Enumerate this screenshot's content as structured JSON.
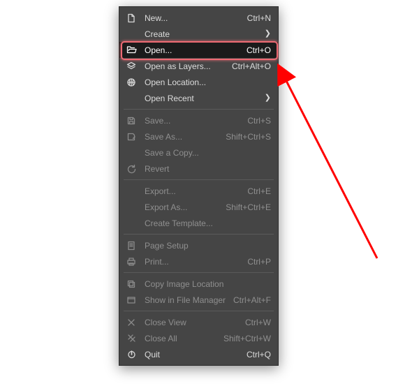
{
  "menu": {
    "groups": [
      [
        {
          "id": "new",
          "icon": "file-new-icon",
          "label": "New...",
          "accel": "Ctrl+N",
          "enabled": true,
          "submenu": false,
          "highlighted": false
        },
        {
          "id": "create",
          "icon": "",
          "label": "Create",
          "accel": "",
          "enabled": true,
          "submenu": true,
          "highlighted": false
        },
        {
          "id": "open",
          "icon": "folder-open-icon",
          "label": "Open...",
          "accel": "Ctrl+O",
          "enabled": true,
          "submenu": false,
          "highlighted": true
        },
        {
          "id": "open-layers",
          "icon": "layers-icon",
          "label": "Open as Layers...",
          "accel": "Ctrl+Alt+O",
          "enabled": true,
          "submenu": false,
          "highlighted": false
        },
        {
          "id": "open-location",
          "icon": "globe-icon",
          "label": "Open Location...",
          "accel": "",
          "enabled": true,
          "submenu": false,
          "highlighted": false
        },
        {
          "id": "open-recent",
          "icon": "",
          "label": "Open Recent",
          "accel": "",
          "enabled": true,
          "submenu": true,
          "highlighted": false
        }
      ],
      [
        {
          "id": "save",
          "icon": "save-icon",
          "label": "Save...",
          "accel": "Ctrl+S",
          "enabled": false,
          "submenu": false,
          "highlighted": false
        },
        {
          "id": "save-as",
          "icon": "save-as-icon",
          "label": "Save As...",
          "accel": "Shift+Ctrl+S",
          "enabled": false,
          "submenu": false,
          "highlighted": false
        },
        {
          "id": "save-copy",
          "icon": "",
          "label": "Save a Copy...",
          "accel": "",
          "enabled": false,
          "submenu": false,
          "highlighted": false
        },
        {
          "id": "revert",
          "icon": "revert-icon",
          "label": "Revert",
          "accel": "",
          "enabled": false,
          "submenu": false,
          "highlighted": false
        }
      ],
      [
        {
          "id": "export",
          "icon": "",
          "label": "Export...",
          "accel": "Ctrl+E",
          "enabled": false,
          "submenu": false,
          "highlighted": false
        },
        {
          "id": "export-as",
          "icon": "",
          "label": "Export As...",
          "accel": "Shift+Ctrl+E",
          "enabled": false,
          "submenu": false,
          "highlighted": false
        },
        {
          "id": "create-template",
          "icon": "",
          "label": "Create Template...",
          "accel": "",
          "enabled": false,
          "submenu": false,
          "highlighted": false
        }
      ],
      [
        {
          "id": "page-setup",
          "icon": "page-setup-icon",
          "label": "Page Setup",
          "accel": "",
          "enabled": false,
          "submenu": false,
          "highlighted": false
        },
        {
          "id": "print",
          "icon": "print-icon",
          "label": "Print...",
          "accel": "Ctrl+P",
          "enabled": false,
          "submenu": false,
          "highlighted": false
        }
      ],
      [
        {
          "id": "copy-location",
          "icon": "copy-location-icon",
          "label": "Copy Image Location",
          "accel": "",
          "enabled": false,
          "submenu": false,
          "highlighted": false
        },
        {
          "id": "show-file-mgr",
          "icon": "file-manager-icon",
          "label": "Show in File Manager",
          "accel": "Ctrl+Alt+F",
          "enabled": false,
          "submenu": false,
          "highlighted": false
        }
      ],
      [
        {
          "id": "close-view",
          "icon": "close-icon",
          "label": "Close View",
          "accel": "Ctrl+W",
          "enabled": false,
          "submenu": false,
          "highlighted": false
        },
        {
          "id": "close-all",
          "icon": "close-all-icon",
          "label": "Close All",
          "accel": "Shift+Ctrl+W",
          "enabled": false,
          "submenu": false,
          "highlighted": false
        },
        {
          "id": "quit",
          "icon": "quit-icon",
          "label": "Quit",
          "accel": "Ctrl+Q",
          "enabled": true,
          "submenu": false,
          "highlighted": false
        }
      ]
    ]
  },
  "annotation": {
    "arrow_color": "#ff0000",
    "highlight_color": "#ee6b74"
  }
}
